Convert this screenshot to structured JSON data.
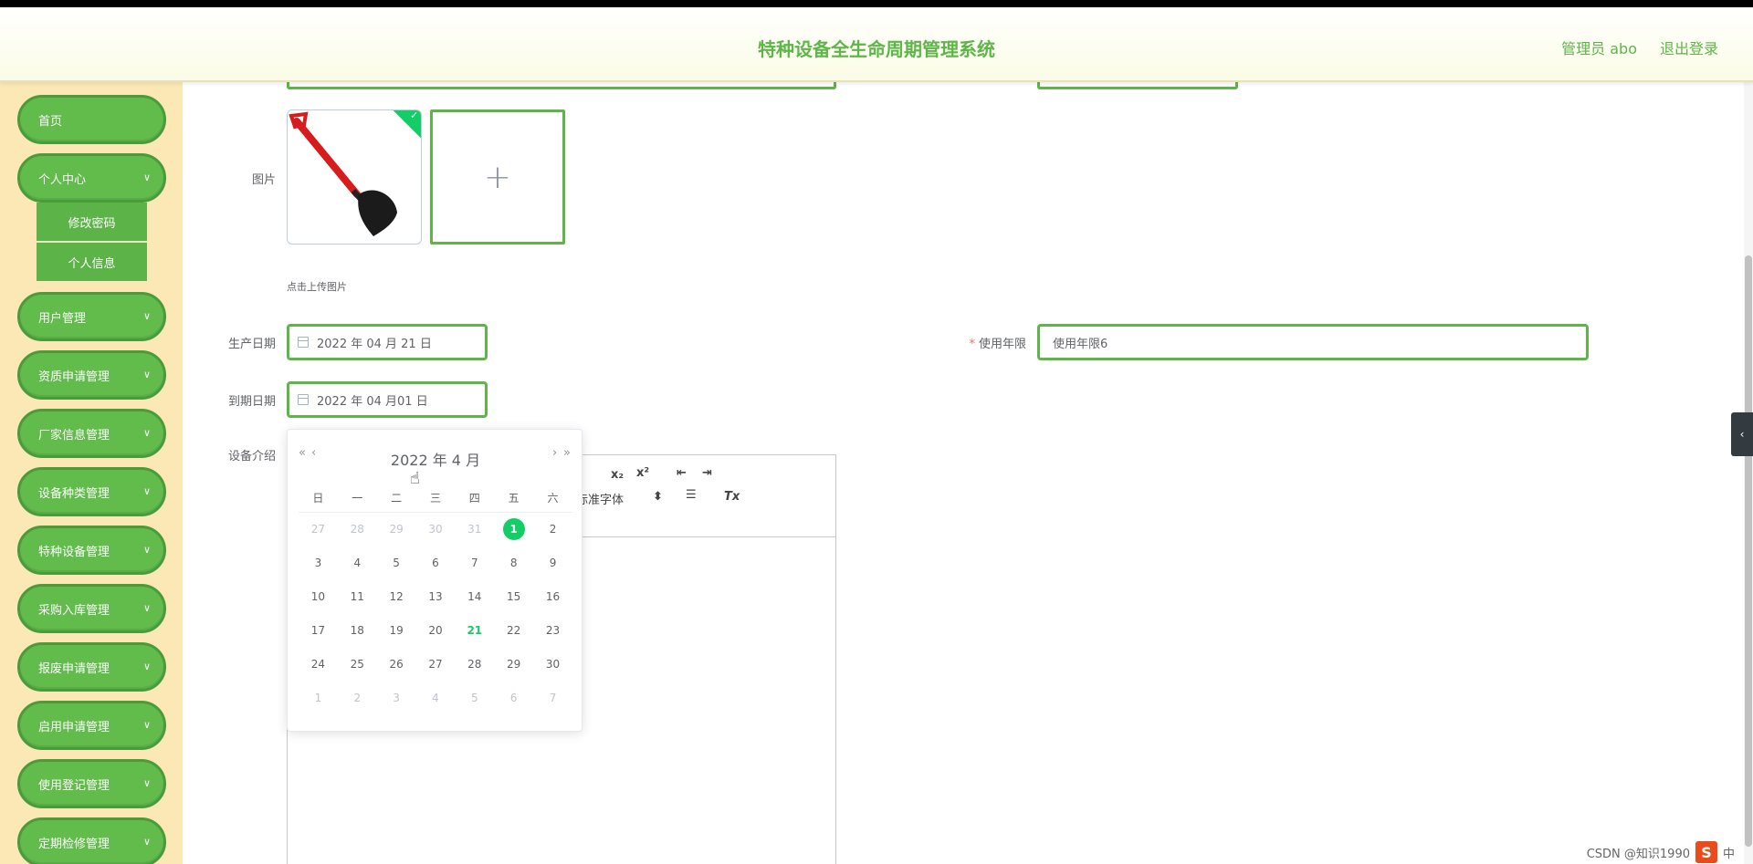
{
  "header": {
    "title": "特种设备全生命周期管理系统",
    "user": "管理员 abo",
    "logout": "退出登录"
  },
  "sidebar": {
    "items": [
      {
        "label": "首页"
      },
      {
        "label": "个人中心"
      },
      {
        "label": "用户管理"
      },
      {
        "label": "资质申请管理"
      },
      {
        "label": "厂家信息管理"
      },
      {
        "label": "设备种类管理"
      },
      {
        "label": "特种设备管理"
      },
      {
        "label": "采购入库管理"
      },
      {
        "label": "报废申请管理"
      },
      {
        "label": "启用申请管理"
      },
      {
        "label": "使用登记管理"
      },
      {
        "label": "定期检修管理"
      }
    ],
    "sub_items": [
      {
        "label": "修改密码"
      },
      {
        "label": "个人信息"
      }
    ]
  },
  "form": {
    "image_label": "图片",
    "upload_tip": "点击上传图片",
    "upload_plus": "+",
    "production_date_label": "生产日期",
    "production_date_value": "2022 年 04 月 21 日",
    "service_life_label": "使用年限",
    "service_life_required": "*",
    "service_life_value": "使用年限6",
    "expiry_date_label": "到期日期",
    "expiry_date_value": "2022 年 04 月01 日",
    "intro_label": "设备介绍"
  },
  "editor": {
    "toolbar": {
      "subscript": "x₂",
      "superscript": "x²",
      "font_select": "标准字体",
      "font_select_arrow": "⬍",
      "align": "☰",
      "clear_format": "Tx"
    }
  },
  "date_picker": {
    "header": "2022 年  4 月",
    "prev_year": "«",
    "prev_month": "‹",
    "next_month": "›",
    "next_year": "»",
    "weekdays": [
      "日",
      "一",
      "二",
      "三",
      "四",
      "五",
      "六"
    ],
    "weeks": [
      [
        {
          "d": "27",
          "t": "other"
        },
        {
          "d": "28",
          "t": "other"
        },
        {
          "d": "29",
          "t": "other"
        },
        {
          "d": "30",
          "t": "other"
        },
        {
          "d": "31",
          "t": "other"
        },
        {
          "d": "1",
          "t": "selected"
        },
        {
          "d": "2",
          "t": ""
        }
      ],
      [
        {
          "d": "3",
          "t": ""
        },
        {
          "d": "4",
          "t": ""
        },
        {
          "d": "5",
          "t": ""
        },
        {
          "d": "6",
          "t": ""
        },
        {
          "d": "7",
          "t": ""
        },
        {
          "d": "8",
          "t": ""
        },
        {
          "d": "9",
          "t": ""
        }
      ],
      [
        {
          "d": "10",
          "t": ""
        },
        {
          "d": "11",
          "t": ""
        },
        {
          "d": "12",
          "t": ""
        },
        {
          "d": "13",
          "t": ""
        },
        {
          "d": "14",
          "t": ""
        },
        {
          "d": "15",
          "t": ""
        },
        {
          "d": "16",
          "t": ""
        }
      ],
      [
        {
          "d": "17",
          "t": ""
        },
        {
          "d": "18",
          "t": ""
        },
        {
          "d": "19",
          "t": ""
        },
        {
          "d": "20",
          "t": ""
        },
        {
          "d": "21",
          "t": "today"
        },
        {
          "d": "22",
          "t": ""
        },
        {
          "d": "23",
          "t": ""
        }
      ],
      [
        {
          "d": "24",
          "t": ""
        },
        {
          "d": "25",
          "t": ""
        },
        {
          "d": "26",
          "t": ""
        },
        {
          "d": "27",
          "t": ""
        },
        {
          "d": "28",
          "t": ""
        },
        {
          "d": "29",
          "t": ""
        },
        {
          "d": "30",
          "t": ""
        }
      ],
      [
        {
          "d": "1",
          "t": "other"
        },
        {
          "d": "2",
          "t": "other"
        },
        {
          "d": "3",
          "t": "other"
        },
        {
          "d": "4",
          "t": "other"
        },
        {
          "d": "5",
          "t": "other"
        },
        {
          "d": "6",
          "t": "other"
        },
        {
          "d": "7",
          "t": "other"
        }
      ]
    ]
  },
  "side_toggle": "‹",
  "watermark": "CSDN @知识1990",
  "taskbar": {
    "ime_logo": "S",
    "ime_text": "中"
  },
  "colors": {
    "accent_green": "#5fb54a",
    "sidebar_bg": "#fbe8b5",
    "today_green": "#13ce66",
    "required_red": "#f56c6c"
  }
}
